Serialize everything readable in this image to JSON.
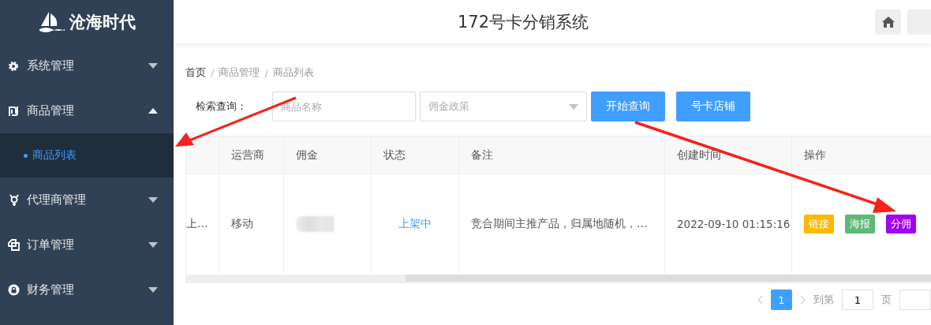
{
  "sidebar": {
    "logo": "沧海时代",
    "items": [
      {
        "label": "系统管理",
        "expanded": false
      },
      {
        "label": "商品管理",
        "expanded": true,
        "children": [
          {
            "label": "商品列表",
            "selected": true
          }
        ]
      },
      {
        "label": "代理商管理",
        "expanded": false
      },
      {
        "label": "订单管理",
        "expanded": false
      },
      {
        "label": "财务管理",
        "expanded": false
      }
    ]
  },
  "header": {
    "title": "172号卡分销系统"
  },
  "breadcrumb": {
    "separator": "/",
    "items": [
      "首页",
      "商品管理",
      "商品列表"
    ]
  },
  "search": {
    "label": "检索查询：",
    "name_placeholder": "商品名称",
    "policy_placeholder": "佣金政策",
    "buttons": [
      "开始查询",
      "号卡店铺"
    ]
  },
  "table": {
    "columns": [
      "运营商",
      "佣金",
      "状态",
      "备注",
      "创建时间",
      "操作"
    ],
    "rows": [
      {
        "column_1": "上…",
        "carrier": "移动",
        "commission": {
          "kind": "redacted"
        },
        "status": "上架中",
        "remark": "竞合期间主推产品，归属地随机，…",
        "created": "2022-09-10 01:15:16",
        "actions": [
          {
            "label": "链接",
            "color": "#ffb800"
          },
          {
            "label": "海报",
            "color": "#5fb878"
          },
          {
            "label": "分佣",
            "color": "#a200f0"
          }
        ]
      }
    ]
  },
  "pagination": {
    "pages": [
      {
        "label": "1",
        "selected": true
      }
    ],
    "goto_label": "到第",
    "goto_value": "1",
    "unit": "页"
  }
}
